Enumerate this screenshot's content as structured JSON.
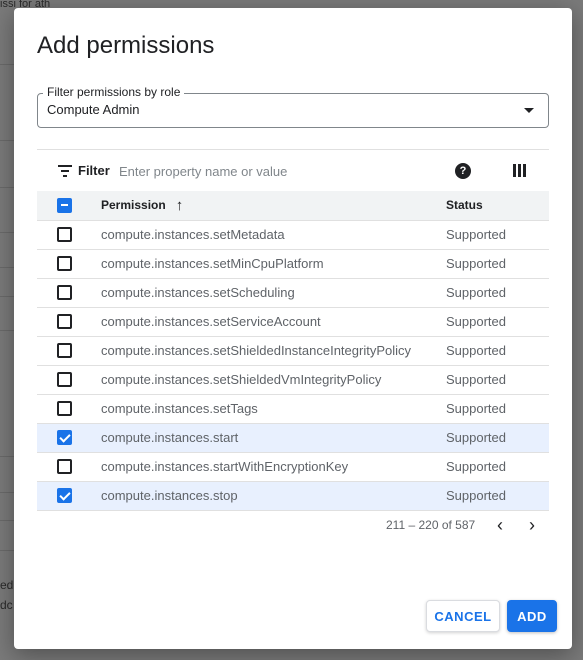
{
  "background": {
    "top_text": "issi        for  ath",
    "left_texts": [
      "ed",
      "dc"
    ]
  },
  "dialog": {
    "title": "Add permissions",
    "role_filter": {
      "legend": "Filter permissions by role",
      "value": "Compute Admin",
      "icon": "chevron-down-icon"
    },
    "filter": {
      "label": "Filter",
      "placeholder": "Enter property name or value",
      "help_icon": "help-icon",
      "help_glyph": "?",
      "columns_icon": "column-display-icon"
    },
    "table": {
      "headers": {
        "permission": "Permission",
        "status": "Status"
      },
      "sort_arrow": "↑",
      "rows": [
        {
          "permission": "compute.instances.setMetadata",
          "status": "Supported",
          "checked": false
        },
        {
          "permission": "compute.instances.setMinCpuPlatform",
          "status": "Supported",
          "checked": false
        },
        {
          "permission": "compute.instances.setScheduling",
          "status": "Supported",
          "checked": false
        },
        {
          "permission": "compute.instances.setServiceAccount",
          "status": "Supported",
          "checked": false
        },
        {
          "permission": "compute.instances.setShieldedInstanceIntegrityPolicy",
          "status": "Supported",
          "checked": false
        },
        {
          "permission": "compute.instances.setShieldedVmIntegrityPolicy",
          "status": "Supported",
          "checked": false
        },
        {
          "permission": "compute.instances.setTags",
          "status": "Supported",
          "checked": false
        },
        {
          "permission": "compute.instances.start",
          "status": "Supported",
          "checked": true
        },
        {
          "permission": "compute.instances.startWithEncryptionKey",
          "status": "Supported",
          "checked": false
        },
        {
          "permission": "compute.instances.stop",
          "status": "Supported",
          "checked": true
        }
      ]
    },
    "pagination": {
      "range": "211 – 220 of 587",
      "prev": "‹",
      "next": "›"
    },
    "actions": {
      "cancel_label": "CANCEL",
      "add_label": "ADD"
    },
    "colors": {
      "accent": "#1a73e8",
      "selected_row": "#e8f0fe",
      "header_row": "#f1f3f4"
    }
  }
}
